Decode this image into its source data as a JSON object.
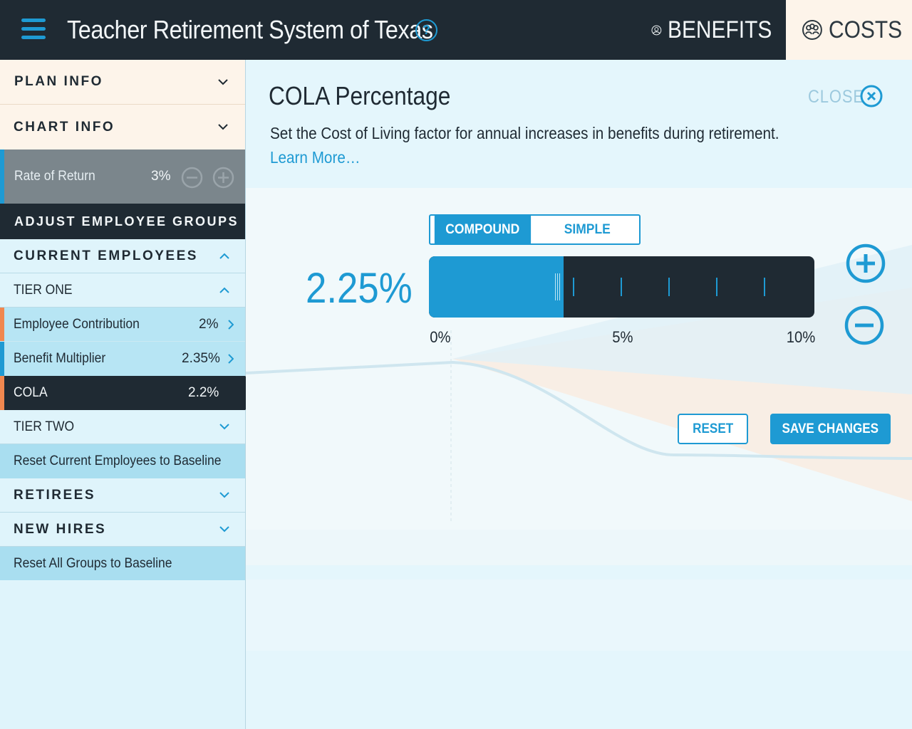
{
  "header": {
    "title": "Teacher Retirement System of Texas",
    "help_label": "?",
    "nav": [
      {
        "label": "BENEFITS",
        "icon": "user-icon",
        "active": false
      },
      {
        "label": "COSTS",
        "icon": "people-group-icon",
        "active": true
      }
    ]
  },
  "sidebar": {
    "plan_info": "PLAN INFO",
    "chart_info": "CHART INFO",
    "rate_of_return": {
      "label": "Rate of Return",
      "value": "3%"
    },
    "adjust_groups": "ADJUST EMPLOYEE GROUPS",
    "current_employees": "CURRENT EMPLOYEES",
    "tier_one": "TIER ONE",
    "employee_contribution": {
      "label": "Employee Contribution",
      "value": "2%"
    },
    "benefit_multiplier": {
      "label": "Benefit Multiplier",
      "value": "2.35%"
    },
    "cola": {
      "label": "COLA",
      "value": "2.2%"
    },
    "tier_two": "TIER TWO",
    "reset_current": "Reset Current Employees to Baseline",
    "retirees": "RETIREES",
    "new_hires": "NEW HIRES",
    "reset_all": "Reset All Groups to Baseline"
  },
  "panel": {
    "title": "COLA Percentage",
    "close_label": "CLOSE",
    "description": "Set the Cost of Living factor for annual increases in benefits during retirement.",
    "learn_more": "Learn More…",
    "mode_options": [
      {
        "label": "COMPOUND",
        "active": true
      },
      {
        "label": "SIMPLE",
        "active": false
      }
    ],
    "value_display": "2.25%",
    "slider": {
      "min": 0,
      "max": 10,
      "value": 2.25,
      "labels": [
        "0%",
        "5%",
        "10%"
      ]
    },
    "reset_label": "RESET",
    "save_label": "SAVE CHANGES"
  },
  "colors": {
    "dark": "#1f2a33",
    "accent_blue": "#1e9ad3",
    "accent_orange": "#f0874f",
    "light_bg": "#dff4fb",
    "cream": "#fdf4ea"
  }
}
